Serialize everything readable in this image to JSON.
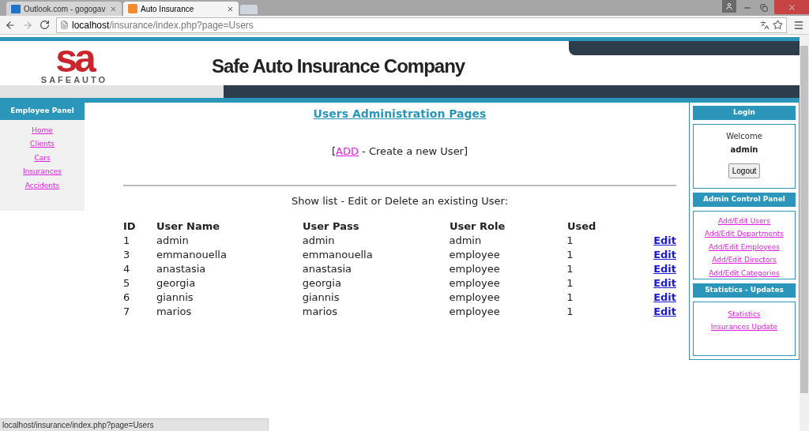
{
  "browser": {
    "tabs": [
      {
        "title": "Outlook.com - gogogav",
        "selected": false
      },
      {
        "title": "Auto Insurance",
        "selected": true
      }
    ],
    "url_host": "localhost",
    "url_path": "/insurance/index.php?page=Users",
    "status_url": "localhost/insurance/index.php?page=Users"
  },
  "header": {
    "logo_mark": "sa",
    "logo_word": "SAFEAUTO",
    "title": "Safe Auto Insurance Company"
  },
  "employee_panel": {
    "title": "Employee Panel",
    "links": [
      "Home",
      "Clients",
      "Cars",
      "Insurances",
      "Accidents"
    ]
  },
  "main": {
    "heading": "Users Administration Pages",
    "add_link": "ADD",
    "add_open": "[",
    "add_text": " - Create a new User]",
    "list_caption": "Show list - Edit or Delete an existing User:",
    "columns": [
      "ID",
      "User Name",
      "User Pass",
      "User Role",
      "Used"
    ],
    "rows": [
      {
        "cells": [
          "1",
          "admin",
          "admin",
          "admin",
          "1"
        ],
        "action": "Edit"
      },
      {
        "cells": [
          "3",
          "emmanouella",
          "emmanouella",
          "employee",
          "1"
        ],
        "action": "Edit"
      },
      {
        "cells": [
          "4",
          "anastasia",
          "anastasia",
          "employee",
          "1"
        ],
        "action": "Edit"
      },
      {
        "cells": [
          "5",
          "georgia",
          "georgia",
          "employee",
          "1"
        ],
        "action": "Edit"
      },
      {
        "cells": [
          "6",
          "giannis",
          "giannis",
          "employee",
          "1"
        ],
        "action": "Edit"
      },
      {
        "cells": [
          "7",
          "marios",
          "marios",
          "employee",
          "1"
        ],
        "action": "Edit"
      }
    ]
  },
  "login": {
    "title": "Login",
    "welcome": "Welcome",
    "user": "admin",
    "button": "Logout"
  },
  "admin_panel": {
    "title": "Admin Control Panel",
    "links": [
      "Add/Edit Users",
      "Add/Edit Departments",
      "Add/Edit Employees",
      "Add/Edit Directors",
      "Add/Edit Categories"
    ]
  },
  "stats_panel": {
    "title": "Statistics - Updates",
    "links": [
      "Statistics",
      "Insurances Update"
    ]
  }
}
